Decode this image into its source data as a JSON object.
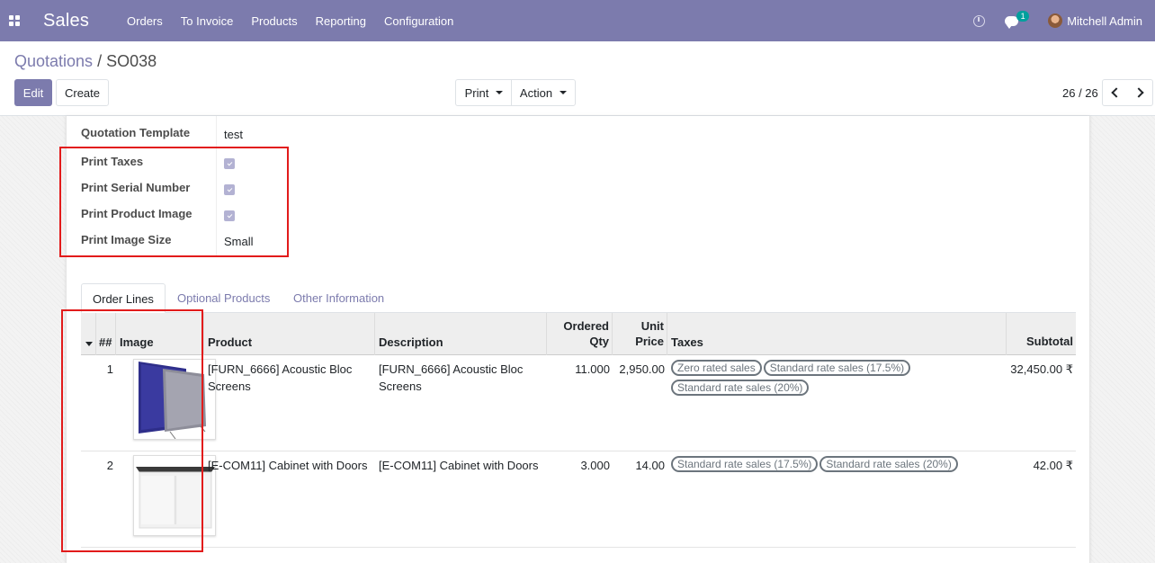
{
  "navbar": {
    "app_title": "Sales",
    "menu": [
      "Orders",
      "To Invoice",
      "Products",
      "Reporting",
      "Configuration"
    ],
    "chat_badge": "1",
    "user": "Mitchell Admin",
    "color": "#7c7bad"
  },
  "breadcrumb": {
    "parent": "Quotations",
    "separator": "/",
    "current": "SO038"
  },
  "buttons": {
    "edit": "Edit",
    "create": "Create",
    "print": "Print",
    "action": "Action"
  },
  "pager": {
    "value": "26 / 26"
  },
  "fields": {
    "quotation_template": {
      "label": "Quotation Template",
      "value": "test"
    },
    "print_taxes": {
      "label": "Print Taxes",
      "checked": true
    },
    "print_serial_number": {
      "label": "Print Serial Number",
      "checked": true
    },
    "print_product_image": {
      "label": "Print Product Image",
      "checked": true
    },
    "print_image_size": {
      "label": "Print Image Size",
      "value": "Small"
    }
  },
  "tabs": [
    "Order Lines",
    "Optional Products",
    "Other Information"
  ],
  "table": {
    "headers": {
      "serial": "##",
      "image": "Image",
      "product": "Product",
      "description": "Description",
      "ordered_qty_1": "Ordered",
      "ordered_qty_2": "Qty",
      "unit_price_1": "Unit",
      "unit_price_2": "Price",
      "taxes": "Taxes",
      "subtotal": "Subtotal"
    },
    "rows": [
      {
        "serial": "1",
        "product": "[FURN_6666] Acoustic Bloc Screens",
        "description": "[FURN_6666] Acoustic Bloc Screens",
        "qty": "11.000",
        "price": "2,950.00",
        "taxes": [
          "Zero rated sales",
          "Standard rate sales (17.5%)",
          "Standard rate sales (20%)"
        ],
        "subtotal": "32,450.00 ₹"
      },
      {
        "serial": "2",
        "product": "[E-COM11] Cabinet with Doors",
        "description": "[E-COM11] Cabinet with Doors",
        "qty": "3.000",
        "price": "14.00",
        "taxes": [
          "Standard rate sales (17.5%)",
          "Standard rate sales (20%)"
        ],
        "subtotal": "42.00 ₹"
      }
    ]
  }
}
